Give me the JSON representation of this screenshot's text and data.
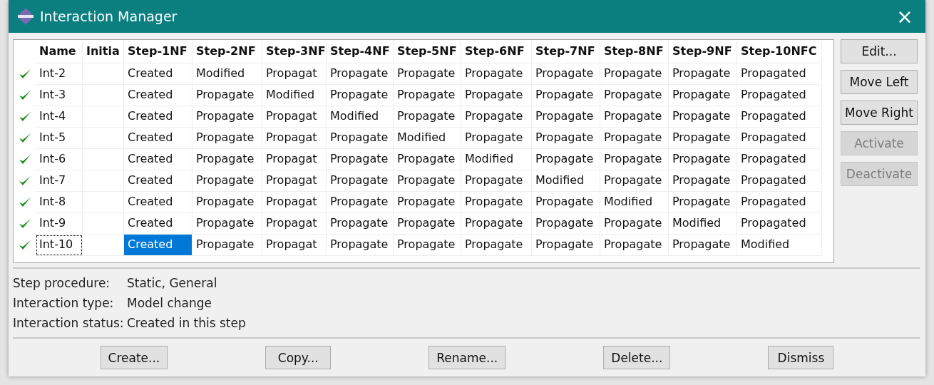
{
  "window": {
    "title": "Interaction Manager",
    "close": "×"
  },
  "table": {
    "columns": [
      "Name",
      "Initia",
      "Step-1NF",
      "Step-2NF",
      "Step-3NF",
      "Step-4NF",
      "Step-5NF",
      "Step-6NF",
      "Step-7NF",
      "Step-8NF",
      "Step-9NF",
      "Step-10NFC"
    ],
    "rows": [
      {
        "active": true,
        "focused": false,
        "cells": [
          {
            "text": "Int-2",
            "selected": false
          },
          {
            "text": "",
            "selected": false
          },
          {
            "text": "Created",
            "selected": false
          },
          {
            "text": "Modified",
            "selected": false
          },
          {
            "text": "Propagat",
            "selected": false
          },
          {
            "text": "Propagate",
            "selected": false
          },
          {
            "text": "Propagate",
            "selected": false
          },
          {
            "text": "Propagate",
            "selected": false
          },
          {
            "text": "Propagate",
            "selected": false
          },
          {
            "text": "Propagate",
            "selected": false
          },
          {
            "text": "Propagate",
            "selected": false
          },
          {
            "text": "Propagated",
            "selected": false
          }
        ]
      },
      {
        "active": true,
        "focused": false,
        "cells": [
          {
            "text": "Int-3",
            "selected": false
          },
          {
            "text": "",
            "selected": false
          },
          {
            "text": "Created",
            "selected": false
          },
          {
            "text": "Propagate",
            "selected": false
          },
          {
            "text": "Modified",
            "selected": false
          },
          {
            "text": "Propagate",
            "selected": false
          },
          {
            "text": "Propagate",
            "selected": false
          },
          {
            "text": "Propagate",
            "selected": false
          },
          {
            "text": "Propagate",
            "selected": false
          },
          {
            "text": "Propagate",
            "selected": false
          },
          {
            "text": "Propagate",
            "selected": false
          },
          {
            "text": "Propagated",
            "selected": false
          }
        ]
      },
      {
        "active": true,
        "focused": false,
        "cells": [
          {
            "text": "Int-4",
            "selected": false
          },
          {
            "text": "",
            "selected": false
          },
          {
            "text": "Created",
            "selected": false
          },
          {
            "text": "Propagate",
            "selected": false
          },
          {
            "text": "Propagat",
            "selected": false
          },
          {
            "text": "Modified",
            "selected": false
          },
          {
            "text": "Propagate",
            "selected": false
          },
          {
            "text": "Propagate",
            "selected": false
          },
          {
            "text": "Propagate",
            "selected": false
          },
          {
            "text": "Propagate",
            "selected": false
          },
          {
            "text": "Propagate",
            "selected": false
          },
          {
            "text": "Propagated",
            "selected": false
          }
        ]
      },
      {
        "active": true,
        "focused": false,
        "cells": [
          {
            "text": "Int-5",
            "selected": false
          },
          {
            "text": "",
            "selected": false
          },
          {
            "text": "Created",
            "selected": false
          },
          {
            "text": "Propagate",
            "selected": false
          },
          {
            "text": "Propagat",
            "selected": false
          },
          {
            "text": "Propagate",
            "selected": false
          },
          {
            "text": "Modified",
            "selected": false
          },
          {
            "text": "Propagate",
            "selected": false
          },
          {
            "text": "Propagate",
            "selected": false
          },
          {
            "text": "Propagate",
            "selected": false
          },
          {
            "text": "Propagate",
            "selected": false
          },
          {
            "text": "Propagated",
            "selected": false
          }
        ]
      },
      {
        "active": true,
        "focused": false,
        "cells": [
          {
            "text": "Int-6",
            "selected": false
          },
          {
            "text": "",
            "selected": false
          },
          {
            "text": "Created",
            "selected": false
          },
          {
            "text": "Propagate",
            "selected": false
          },
          {
            "text": "Propagat",
            "selected": false
          },
          {
            "text": "Propagate",
            "selected": false
          },
          {
            "text": "Propagate",
            "selected": false
          },
          {
            "text": "Modified",
            "selected": false
          },
          {
            "text": "Propagate",
            "selected": false
          },
          {
            "text": "Propagate",
            "selected": false
          },
          {
            "text": "Propagate",
            "selected": false
          },
          {
            "text": "Propagated",
            "selected": false
          }
        ]
      },
      {
        "active": true,
        "focused": false,
        "cells": [
          {
            "text": "Int-7",
            "selected": false
          },
          {
            "text": "",
            "selected": false
          },
          {
            "text": "Created",
            "selected": false
          },
          {
            "text": "Propagate",
            "selected": false
          },
          {
            "text": "Propagat",
            "selected": false
          },
          {
            "text": "Propagate",
            "selected": false
          },
          {
            "text": "Propagate",
            "selected": false
          },
          {
            "text": "Propagate",
            "selected": false
          },
          {
            "text": "Modified",
            "selected": false
          },
          {
            "text": "Propagate",
            "selected": false
          },
          {
            "text": "Propagate",
            "selected": false
          },
          {
            "text": "Propagated",
            "selected": false
          }
        ]
      },
      {
        "active": true,
        "focused": false,
        "cells": [
          {
            "text": "Int-8",
            "selected": false
          },
          {
            "text": "",
            "selected": false
          },
          {
            "text": "Created",
            "selected": false
          },
          {
            "text": "Propagate",
            "selected": false
          },
          {
            "text": "Propagat",
            "selected": false
          },
          {
            "text": "Propagate",
            "selected": false
          },
          {
            "text": "Propagate",
            "selected": false
          },
          {
            "text": "Propagate",
            "selected": false
          },
          {
            "text": "Propagate",
            "selected": false
          },
          {
            "text": "Modified",
            "selected": false
          },
          {
            "text": "Propagate",
            "selected": false
          },
          {
            "text": "Propagated",
            "selected": false
          }
        ]
      },
      {
        "active": true,
        "focused": false,
        "cells": [
          {
            "text": "Int-9",
            "selected": false
          },
          {
            "text": "",
            "selected": false
          },
          {
            "text": "Created",
            "selected": false
          },
          {
            "text": "Propagate",
            "selected": false
          },
          {
            "text": "Propagat",
            "selected": false
          },
          {
            "text": "Propagate",
            "selected": false
          },
          {
            "text": "Propagate",
            "selected": false
          },
          {
            "text": "Propagate",
            "selected": false
          },
          {
            "text": "Propagate",
            "selected": false
          },
          {
            "text": "Propagate",
            "selected": false
          },
          {
            "text": "Modified",
            "selected": false
          },
          {
            "text": "Propagated",
            "selected": false
          }
        ]
      },
      {
        "active": true,
        "focused": true,
        "cells": [
          {
            "text": "Int-10",
            "selected": false
          },
          {
            "text": "",
            "selected": false
          },
          {
            "text": "Created",
            "selected": true
          },
          {
            "text": "Propagate",
            "selected": false
          },
          {
            "text": "Propagat",
            "selected": false
          },
          {
            "text": "Propagate",
            "selected": false
          },
          {
            "text": "Propagate",
            "selected": false
          },
          {
            "text": "Propagate",
            "selected": false
          },
          {
            "text": "Propagate",
            "selected": false
          },
          {
            "text": "Propagate",
            "selected": false
          },
          {
            "text": "Propagate",
            "selected": false
          },
          {
            "text": "Modified",
            "selected": false
          }
        ]
      }
    ]
  },
  "side_buttons": [
    {
      "label": "Edit...",
      "disabled": false
    },
    {
      "label": "Move Left",
      "disabled": false
    },
    {
      "label": "Move Right",
      "disabled": false
    },
    {
      "label": "Activate",
      "disabled": true
    },
    {
      "label": "Deactivate",
      "disabled": true
    }
  ],
  "details": [
    {
      "label": "Step procedure:",
      "value": "Static, General"
    },
    {
      "label": "Interaction type:",
      "value": "Model change"
    },
    {
      "label": "Interaction status:",
      "value": "Created in this step"
    }
  ],
  "bottom_buttons": [
    "Create...",
    "Copy...",
    "Rename...",
    "Delete...",
    "Dismiss"
  ]
}
